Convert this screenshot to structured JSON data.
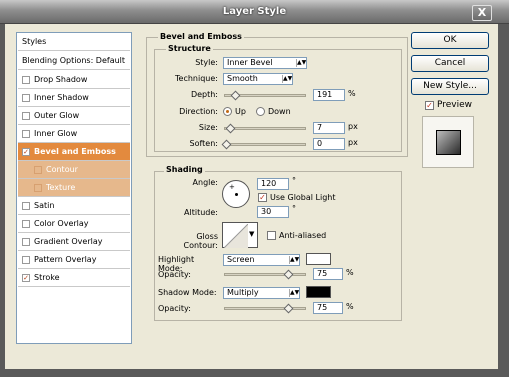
{
  "window": {
    "title": "Layer Style",
    "close_glyph": "X"
  },
  "styles_list": {
    "header": "Styles",
    "blending": "Blending Options: Default",
    "items": [
      {
        "label": "Drop Shadow",
        "checked": false
      },
      {
        "label": "Inner Shadow",
        "checked": false
      },
      {
        "label": "Outer Glow",
        "checked": false
      },
      {
        "label": "Inner Glow",
        "checked": false
      },
      {
        "label": "Bevel and Emboss",
        "checked": true
      },
      {
        "label": "Contour",
        "checked": false
      },
      {
        "label": "Texture",
        "checked": false
      },
      {
        "label": "Satin",
        "checked": false
      },
      {
        "label": "Color Overlay",
        "checked": false
      },
      {
        "label": "Gradient Overlay",
        "checked": false
      },
      {
        "label": "Pattern Overlay",
        "checked": false
      },
      {
        "label": "Stroke",
        "checked": true
      }
    ]
  },
  "bevel": {
    "title": "Bevel and Emboss",
    "structure": {
      "title": "Structure",
      "style_label": "Style:",
      "style_value": "Inner Bevel",
      "technique_label": "Technique:",
      "technique_value": "Smooth",
      "depth_label": "Depth:",
      "depth_value": "191",
      "depth_unit": "%",
      "direction_label": "Direction:",
      "dir_up": "Up",
      "dir_down": "Down",
      "size_label": "Size:",
      "size_value": "7",
      "size_unit": "px",
      "soften_label": "Soften:",
      "soften_value": "0",
      "soften_unit": "px"
    },
    "shading": {
      "title": "Shading",
      "angle_label": "Angle:",
      "angle_value": "120",
      "angle_unit": "°",
      "global_light": "Use Global Light",
      "altitude_label": "Altitude:",
      "altitude_value": "30",
      "altitude_unit": "°",
      "gloss_label": "Gloss Contour:",
      "anti_aliased": "Anti-aliased",
      "highlight_label": "Highlight Mode:",
      "highlight_value": "Screen",
      "highlight_color": "#ffffff",
      "opacity_label": "Opacity:",
      "hl_opacity": "75",
      "pct": "%",
      "shadow_label": "Shadow Mode:",
      "shadow_value": "Multiply",
      "shadow_color": "#000000",
      "sh_opacity": "75"
    }
  },
  "buttons": {
    "ok": "OK",
    "cancel": "Cancel",
    "new_style": "New Style...",
    "preview": "Preview"
  }
}
